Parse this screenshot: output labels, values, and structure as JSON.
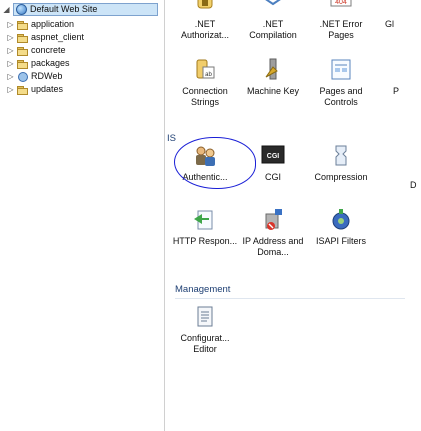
{
  "tree": {
    "root": {
      "label": "Default Web Site",
      "expander": "◢"
    },
    "items": [
      {
        "label": "application",
        "icon": "folder-icon"
      },
      {
        "label": "aspnet_client",
        "icon": "folder-icon"
      },
      {
        "label": "concrete",
        "icon": "folder-icon"
      },
      {
        "label": "packages",
        "icon": "folder-icon"
      },
      {
        "label": "RDWeb",
        "icon": "application-icon"
      },
      {
        "label": "updates",
        "icon": "folder-icon"
      }
    ],
    "collapsed_glyph": "▷"
  },
  "features": {
    "row1": [
      {
        "label": ".NET Authorizat...",
        "icon": "net-authorization-icon"
      },
      {
        "label": ".NET Compilation",
        "icon": "net-compilation-icon"
      },
      {
        "label": ".NET Error Pages",
        "icon": "net-error-pages-icon",
        "badge": "404"
      },
      {
        "label": "Gl",
        "icon": "globalization-icon"
      }
    ],
    "row2": [
      {
        "label": "Connection Strings",
        "icon": "connection-strings-icon",
        "badge": "ab"
      },
      {
        "label": "Machine Key",
        "icon": "machine-key-icon"
      },
      {
        "label": "Pages and Controls",
        "icon": "pages-controls-icon"
      },
      {
        "label": "P",
        "icon": "providers-icon"
      }
    ],
    "iis_group_title": "IS",
    "row3": [
      {
        "label": "Authentic...",
        "icon": "authentication-icon"
      },
      {
        "label": "CGI",
        "icon": "cgi-icon",
        "badge": "CGI"
      },
      {
        "label": "Compression",
        "icon": "compression-icon"
      },
      {
        "label": "D",
        "icon": "default-document-icon"
      }
    ],
    "row4": [
      {
        "label": "HTTP Respon...",
        "icon": "http-response-icon"
      },
      {
        "label": "IP Address and Doma...",
        "icon": "ip-address-icon"
      },
      {
        "label": "ISAPI Filters",
        "icon": "isapi-filters-icon"
      }
    ],
    "management_group_title": "Management",
    "row5": [
      {
        "label": "Configurat... Editor",
        "icon": "configuration-editor-icon"
      }
    ]
  }
}
